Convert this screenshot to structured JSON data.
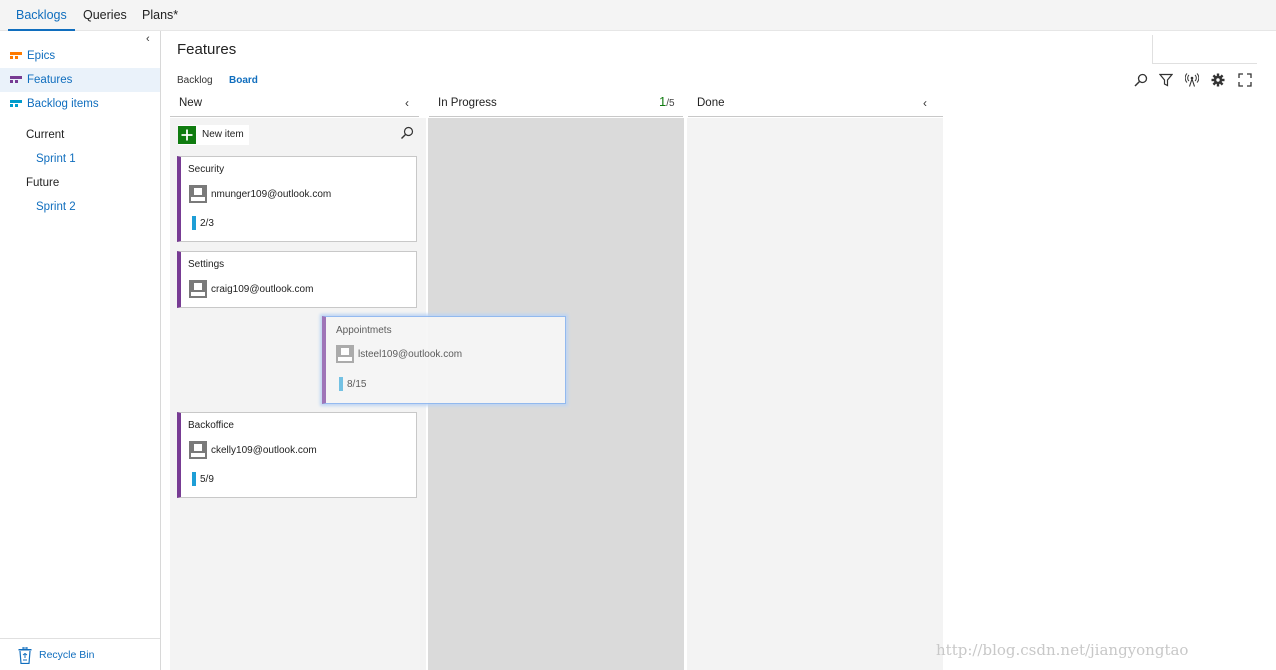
{
  "topnav": {
    "tabs": [
      {
        "label": "Backlogs"
      },
      {
        "label": "Queries"
      },
      {
        "label": "Plans*"
      }
    ]
  },
  "sidebar": {
    "collapse_glyph": "‹",
    "items": [
      {
        "label": "Epics",
        "icon": "epic-backlog-icon",
        "color": "#ff7b00"
      },
      {
        "label": "Features",
        "icon": "feature-backlog-icon",
        "color": "#773b93"
      },
      {
        "label": "Backlog items",
        "icon": "backlog-items-icon",
        "color": "#009ccc"
      }
    ],
    "sections": [
      {
        "label": "Current",
        "sprints": [
          "Sprint 1"
        ]
      },
      {
        "label": "Future",
        "sprints": [
          "Sprint 2"
        ]
      }
    ],
    "recycle_bin": {
      "label": "Recycle Bin",
      "icon": "recycle-bin-icon"
    }
  },
  "header": {
    "title": "Features",
    "pivots": [
      {
        "label": "Backlog"
      },
      {
        "label": "Board"
      }
    ],
    "toolbar_icons": [
      "search-icon",
      "filter-icon",
      "live-updates-icon",
      "settings-icon",
      "fullscreen-icon"
    ]
  },
  "board": {
    "columns": [
      {
        "title": "New",
        "chevron": "‹"
      },
      {
        "title": "In Progress",
        "wip_current": "1",
        "wip_limit": "/5"
      },
      {
        "title": "Done",
        "chevron": "‹"
      }
    ],
    "new_item_label": "New item",
    "cards": [
      {
        "title": "Security",
        "assignee": "nmunger109@outlook.com",
        "progress": "2/3"
      },
      {
        "title": "Settings",
        "assignee": "craig109@outlook.com"
      },
      {
        "title": "Appointmets",
        "assignee": "lsteel109@outlook.com",
        "progress": "8/15",
        "state": "dragging"
      },
      {
        "title": "Backoffice",
        "assignee": "ckelly109@outlook.com",
        "progress": "5/9"
      }
    ]
  },
  "colors": {
    "accent": "#106ebe",
    "feature_purple": "#773b93",
    "progress_blue": "#1e9ed6",
    "add_green": "#107c10"
  },
  "watermark": "http://blog.csdn.net/jiangyongtao"
}
